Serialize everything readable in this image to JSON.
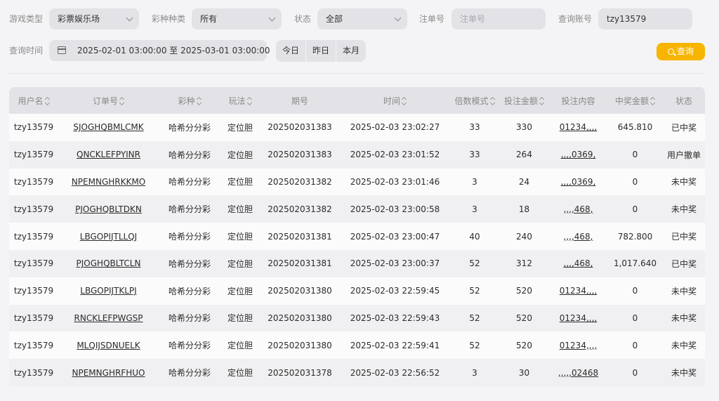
{
  "filters": {
    "game_type": {
      "label": "游戏类型",
      "value": "彩票娱乐场"
    },
    "lottery_kind": {
      "label": "彩种种类",
      "value": "所有"
    },
    "status": {
      "label": "状态",
      "value": "全部"
    },
    "order_no": {
      "label": "注单号",
      "placeholder": "注单号"
    },
    "account": {
      "label": "查询账号",
      "value": "tzy13579"
    },
    "time": {
      "label": "查询时间",
      "value": "2025-02-01 03:00:00 至 2025-03-01 03:00:00"
    },
    "quick": [
      "今日",
      "昨日",
      "本月"
    ],
    "search_label": "查询"
  },
  "table": {
    "headers": [
      "用户名",
      "订单号",
      "彩种",
      "玩法",
      "期号",
      "时间",
      "倍数模式",
      "投注金额",
      "投注内容",
      "中奖金额",
      "状态"
    ],
    "rows": [
      [
        "tzy13579",
        "SJOGHQBMLCMK",
        "哈希分分彩",
        "定位胆",
        "202502031383",
        "2025-02-03 23:02:27",
        "33",
        "330",
        "01234,,,,",
        "645.810",
        "已中奖"
      ],
      [
        "tzy13579",
        "QNCKLEFPYINR",
        "哈希分分彩",
        "定位胆",
        "202502031383",
        "2025-02-03 23:01:52",
        "33",
        "264",
        ",,,,0369,",
        "0",
        "用户撤单"
      ],
      [
        "tzy13579",
        "NPEMNGHRKKMO",
        "哈希分分彩",
        "定位胆",
        "202502031382",
        "2025-02-03 23:01:46",
        "3",
        "24",
        ",,,,0369,",
        "0",
        "未中奖"
      ],
      [
        "tzy13579",
        "PJOGHQBLTDKN",
        "哈希分分彩",
        "定位胆",
        "202502031382",
        "2025-02-03 23:00:58",
        "3",
        "18",
        ",,,,468,",
        "0",
        "未中奖"
      ],
      [
        "tzy13579",
        "LBGOPIJTLLQJ",
        "哈希分分彩",
        "定位胆",
        "202502031381",
        "2025-02-03 23:00:47",
        "40",
        "240",
        ",,,,468,",
        "782.800",
        "已中奖"
      ],
      [
        "tzy13579",
        "PJOGHQBLTCLN",
        "哈希分分彩",
        "定位胆",
        "202502031381",
        "2025-02-03 23:00:37",
        "52",
        "312",
        ",,,,468,",
        "1,017.640",
        "已中奖"
      ],
      [
        "tzy13579",
        "LBGOPIJTKLPJ",
        "哈希分分彩",
        "定位胆",
        "202502031380",
        "2025-02-03 22:59:45",
        "52",
        "520",
        "01234,,,,",
        "0",
        "未中奖"
      ],
      [
        "tzy13579",
        "RNCKLEFPWGSP",
        "哈希分分彩",
        "定位胆",
        "202502031380",
        "2025-02-03 22:59:43",
        "52",
        "520",
        "01234,,,,",
        "0",
        "未中奖"
      ],
      [
        "tzy13579",
        "MLQIJSDNUELK",
        "哈希分分彩",
        "定位胆",
        "202502031380",
        "2025-02-03 22:59:41",
        "52",
        "520",
        "01234,,,,",
        "0",
        "未中奖"
      ],
      [
        "tzy13579",
        "NPEMNGHRFHUO",
        "哈希分分彩",
        "定位胆",
        "202502031378",
        "2025-02-03 22:56:52",
        "3",
        "30",
        ",,,,,02468",
        "0",
        "未中奖"
      ]
    ]
  },
  "icons": {
    "dropdown": "chevron-down-icon",
    "calendar": "calendar-icon",
    "search": "search-icon",
    "sort": "sort-icon"
  },
  "colors": {
    "accent": "#f7b500",
    "header_bg": "#e3e3e7",
    "page_bg": "#f4f4f6"
  }
}
